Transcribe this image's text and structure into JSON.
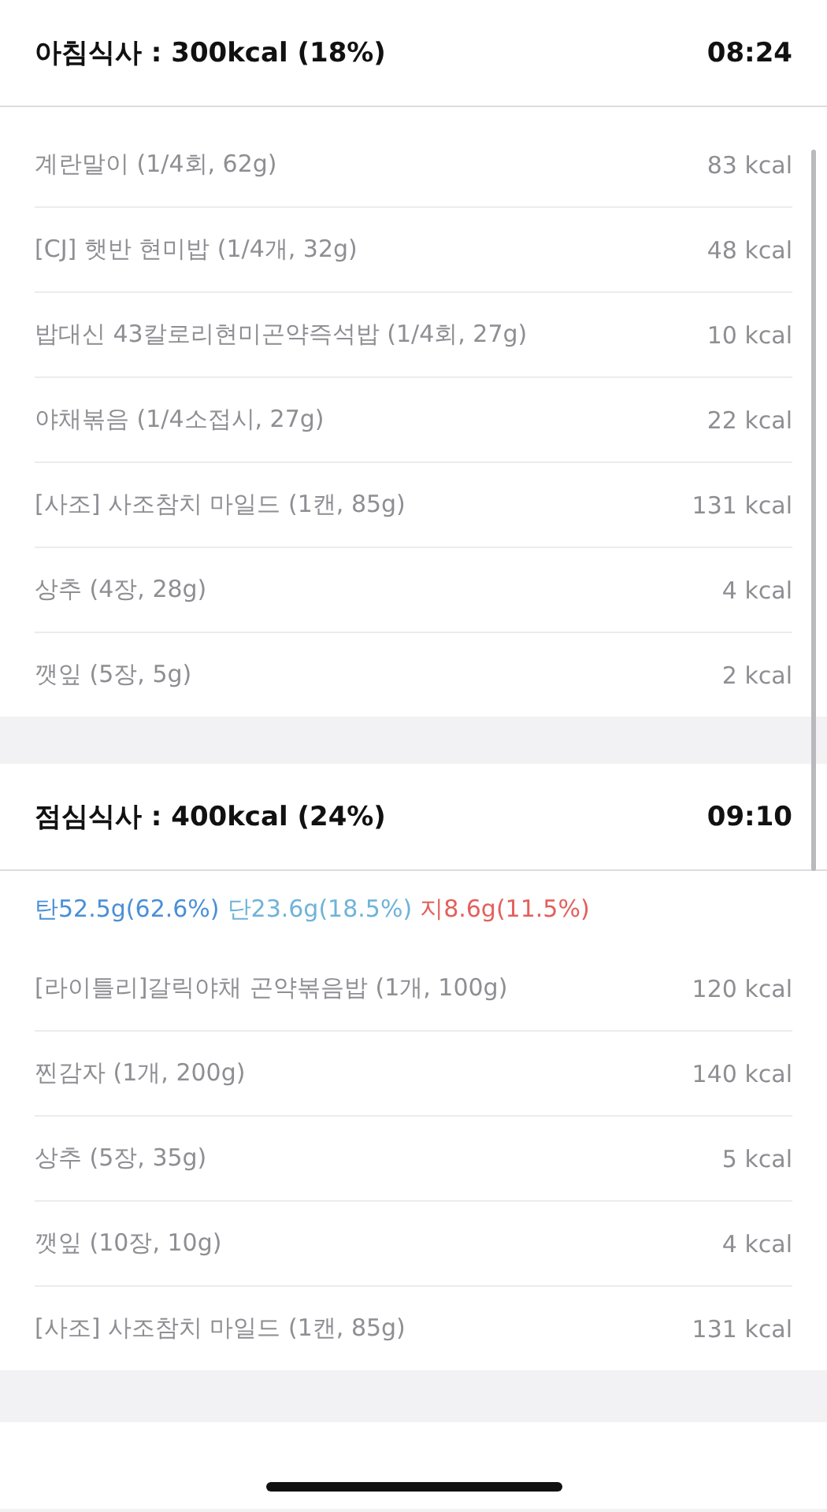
{
  "meals": [
    {
      "title": "아침식사 : 300kcal (18%)",
      "time": "08:24",
      "items": [
        {
          "name": "계란말이 (1/4회, 62g)",
          "kcal": "83 kcal"
        },
        {
          "name": "[CJ] 햇반 현미밥 (1/4개, 32g)",
          "kcal": "48 kcal"
        },
        {
          "name": "밥대신 43칼로리현미곤약즉석밥 (1/4회, 27g)",
          "kcal": "10 kcal"
        },
        {
          "name": "야채볶음 (1/4소접시, 27g)",
          "kcal": "22 kcal"
        },
        {
          "name": "[사조] 사조참치 마일드 (1캔, 85g)",
          "kcal": "131 kcal"
        },
        {
          "name": "상추 (4장, 28g)",
          "kcal": "4 kcal"
        },
        {
          "name": "깻잎 (5장, 5g)",
          "kcal": "2 kcal"
        }
      ]
    },
    {
      "title": "점심식사 : 400kcal (24%)",
      "time": "09:10",
      "macros": [
        {
          "text": "탄52.5g(62.6%)",
          "color": "#4a8fd6"
        },
        {
          "text": "단23.6g(18.5%)",
          "color": "#6fb3d8"
        },
        {
          "text": "지8.6g(11.5%)",
          "color": "#e2605c"
        }
      ],
      "items": [
        {
          "name": "[라이틀리]갈릭야채 곤약볶음밥 (1개, 100g)",
          "kcal": "120 kcal"
        },
        {
          "name": "찐감자 (1개, 200g)",
          "kcal": "140 kcal"
        },
        {
          "name": "상추 (5장, 35g)",
          "kcal": "5 kcal"
        },
        {
          "name": "깻잎 (10장, 10g)",
          "kcal": "4 kcal"
        },
        {
          "name": "[사조] 사조참치 마일드 (1캔, 85g)",
          "kcal": "131 kcal"
        }
      ]
    }
  ]
}
